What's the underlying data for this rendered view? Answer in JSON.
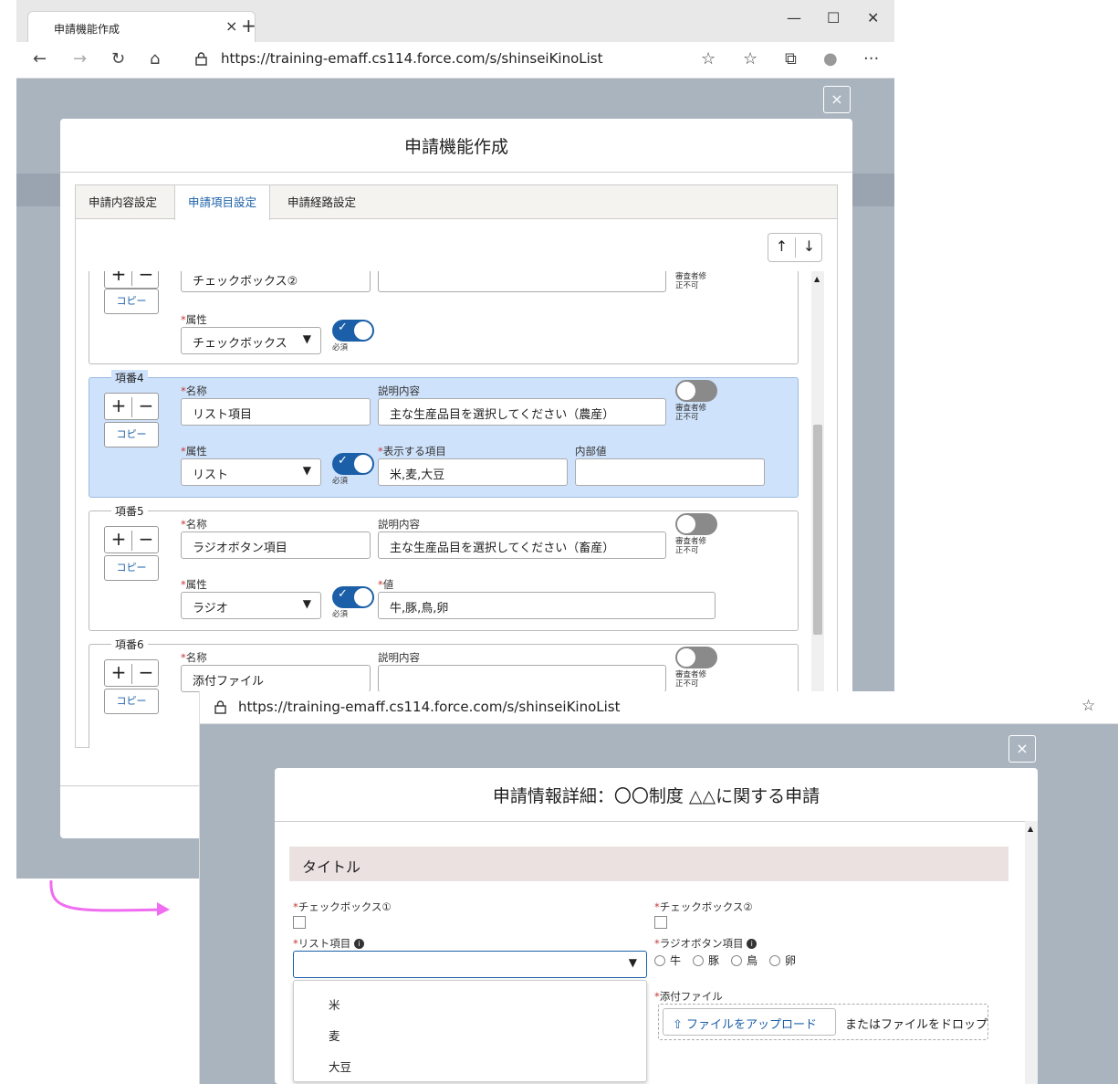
{
  "colors": {
    "accent": "#1b5fa8",
    "highlight_card": "#cfe2fb",
    "overlay": "#aab4bf",
    "section_bg": "#ece1e1",
    "arrow": "#f06cf0",
    "required": "#c23934"
  },
  "window1": {
    "tab_title": "申請機能作成",
    "tab_close": "×",
    "new_tab": "+",
    "controls": {
      "minimize": "—",
      "maximize": "☐",
      "close": "✕"
    },
    "nav": {
      "back": "←",
      "forward": "→",
      "refresh": "↻",
      "home": "⌂",
      "lock": "🔒",
      "star": "☆",
      "favorites": "☆",
      "collections": "⧉",
      "profile": "●",
      "more": "···"
    },
    "url": "https://training-emaff.cs114.force.com/s/shinseiKinoList",
    "close_button": "×",
    "modal": {
      "title": "申請機能作成",
      "tabs": [
        "申請内容設定",
        "申請項目設定",
        "申請経路設定"
      ],
      "up_arrow": "↑",
      "down_arrow": "↓",
      "plus": "+",
      "minus": "−",
      "copy": "コピー",
      "labels": {
        "name": "名称",
        "description": "説明内容",
        "attribute": "属性",
        "display_items": "表示する項目",
        "internal_value": "内部値",
        "value": "値",
        "required": "必須",
        "reviewer_toggle_1": "審査者修",
        "reviewer_toggle_2": "正不可",
        "req_mark": "*"
      },
      "partial_item": {
        "name": "チェックボックス②",
        "attribute": "チェックボックス"
      },
      "items": [
        {
          "number": "項番4",
          "name": "リスト項目",
          "description": "主な生産品目を選択してください（農産）",
          "attribute": "リスト",
          "display_items": "米,麦,大豆",
          "internal_value": ""
        },
        {
          "number": "項番5",
          "name": "ラジオボタン項目",
          "description": "主な生産品目を選択してください（畜産）",
          "attribute": "ラジオ",
          "value": "牛,豚,鳥,卵"
        },
        {
          "number": "項番6",
          "name": "添付ファイル",
          "description": ""
        }
      ]
    }
  },
  "window2": {
    "url": "https://training-emaff.cs114.force.com/s/shinseiKinoList",
    "star": "☆",
    "close_button": "×",
    "modal": {
      "title": "申請情報詳細：〇〇制度 △△に関する申請",
      "section_title": "タイトル",
      "req_mark": "*",
      "checkbox1_label": "チェックボックス①",
      "checkbox2_label": "チェックボックス②",
      "list_label": "リスト項目",
      "radio_label": "ラジオボタン項目",
      "info": "i",
      "radio_options": [
        "牛",
        "豚",
        "鳥",
        "卵"
      ],
      "file_label": "添付ファイル",
      "upload_button": "ファイルをアップロード",
      "upload_icon": "⇧",
      "drop_text": "またはファイルをドロップ",
      "dropdown_arrow": "▼",
      "dropdown_options": [
        "米",
        "麦",
        "大豆"
      ]
    }
  }
}
